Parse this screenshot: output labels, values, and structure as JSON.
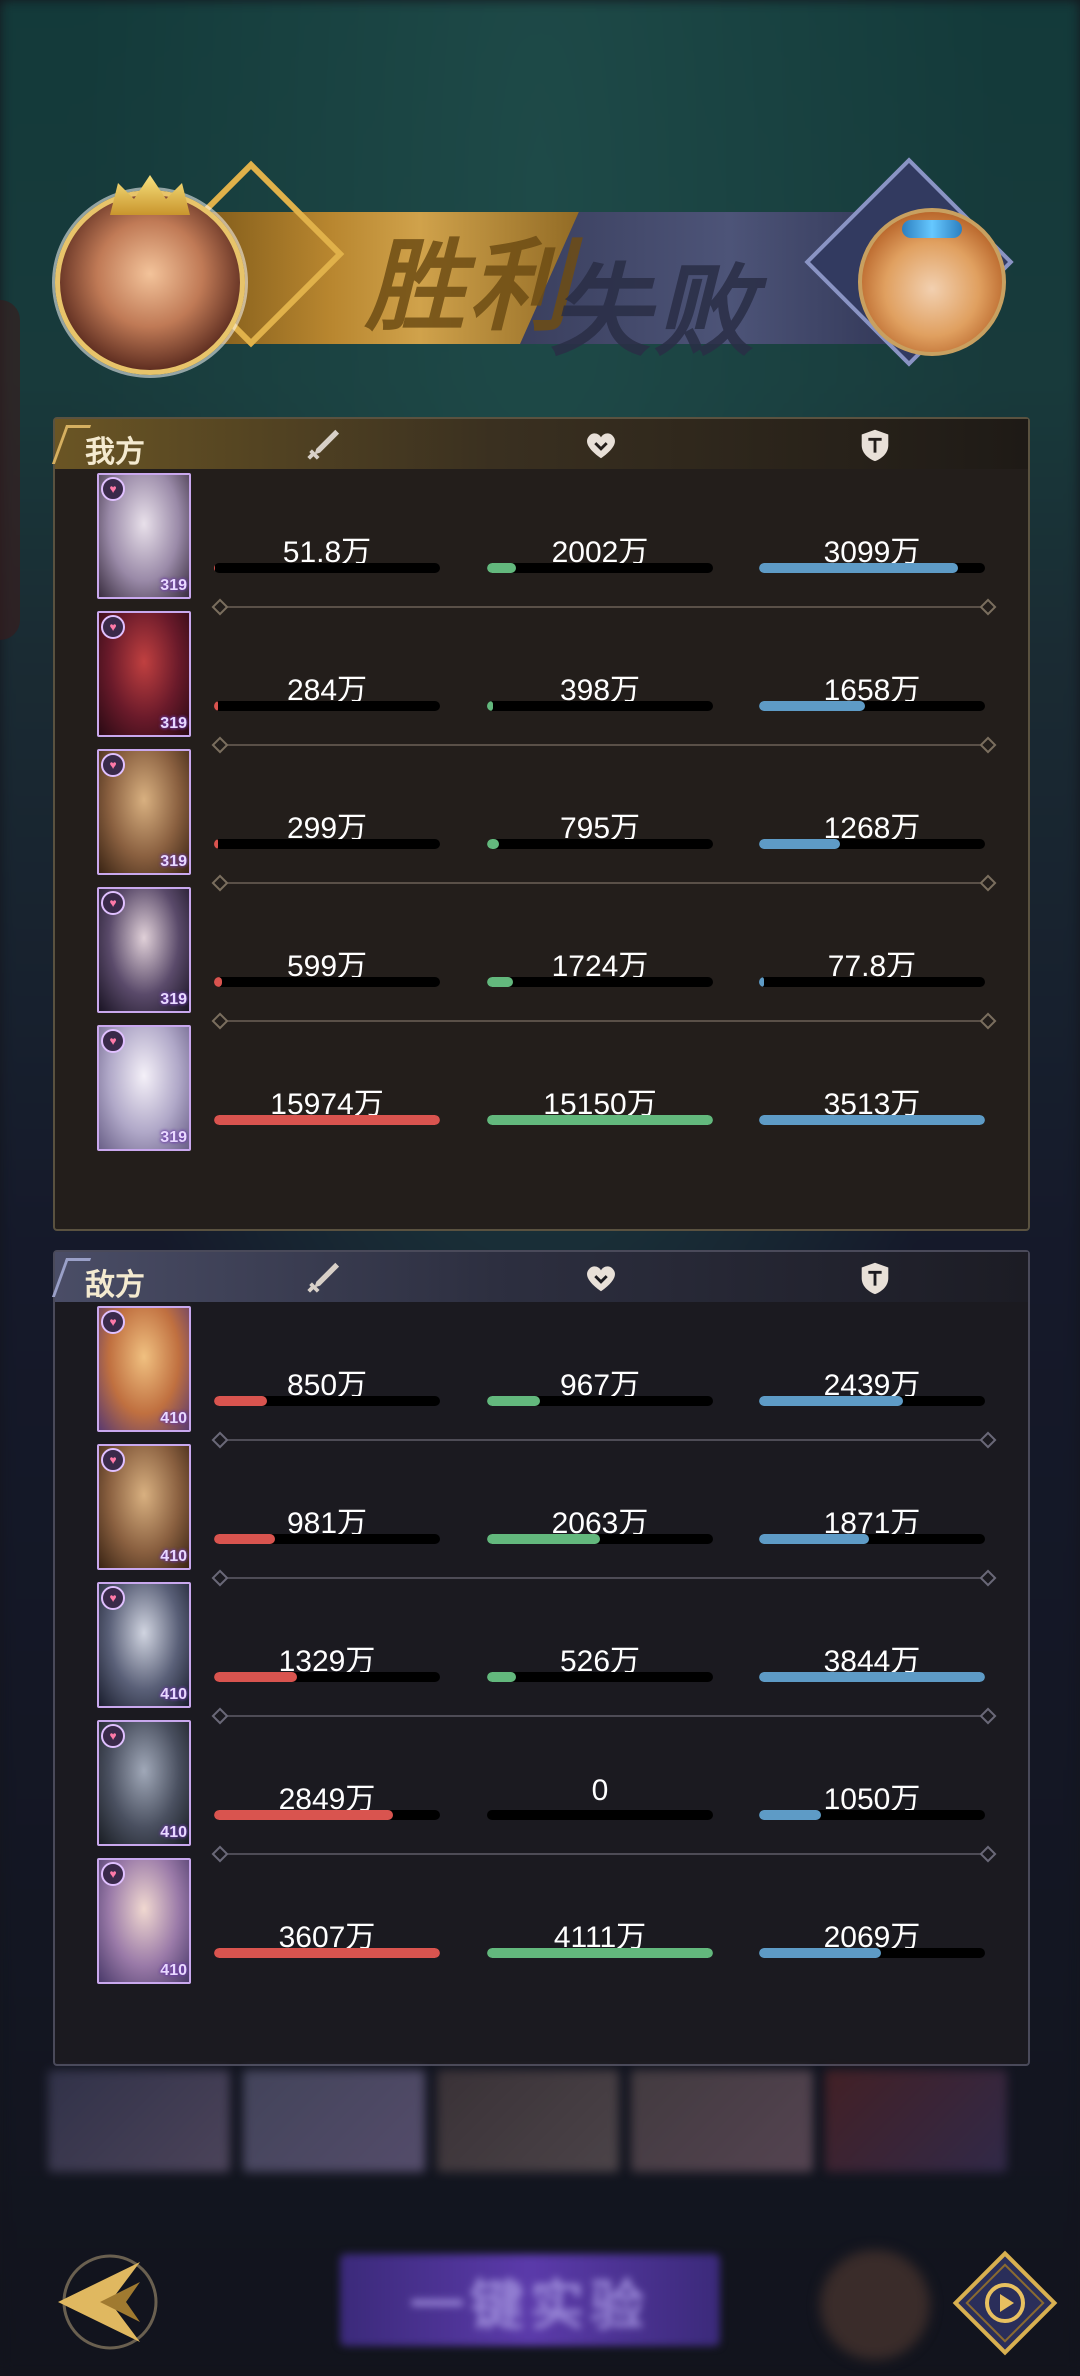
{
  "banner": {
    "victory_text": "胜利",
    "defeat_text": "失败"
  },
  "ours": {
    "label": "我方",
    "rows": [
      {
        "hero_level": "319",
        "damage": "51.8万",
        "heal": "2002万",
        "tank": "3099万",
        "damage_pct": 0.003,
        "heal_pct": 0.13,
        "tank_pct": 0.88
      },
      {
        "hero_level": "319",
        "damage": "284万",
        "heal": "398万",
        "tank": "1658万",
        "damage_pct": 0.018,
        "heal_pct": 0.026,
        "tank_pct": 0.47
      },
      {
        "hero_level": "319",
        "damage": "299万",
        "heal": "795万",
        "tank": "1268万",
        "damage_pct": 0.019,
        "heal_pct": 0.052,
        "tank_pct": 0.36
      },
      {
        "hero_level": "319",
        "damage": "599万",
        "heal": "1724万",
        "tank": "77.8万",
        "damage_pct": 0.037,
        "heal_pct": 0.114,
        "tank_pct": 0.022
      },
      {
        "hero_level": "319",
        "damage": "15974万",
        "heal": "15150万",
        "tank": "3513万",
        "damage_pct": 1.0,
        "heal_pct": 1.0,
        "tank_pct": 1.0
      }
    ]
  },
  "enemy": {
    "label": "敌方",
    "rows": [
      {
        "hero_level": "410",
        "damage": "850万",
        "heal": "967万",
        "tank": "2439万",
        "damage_pct": 0.236,
        "heal_pct": 0.235,
        "tank_pct": 0.635
      },
      {
        "hero_level": "410",
        "damage": "981万",
        "heal": "2063万",
        "tank": "1871万",
        "damage_pct": 0.272,
        "heal_pct": 0.502,
        "tank_pct": 0.487
      },
      {
        "hero_level": "410",
        "damage": "1329万",
        "heal": "526万",
        "tank": "3844万",
        "damage_pct": 0.368,
        "heal_pct": 0.128,
        "tank_pct": 1.0
      },
      {
        "hero_level": "410",
        "damage": "2849万",
        "heal": "0",
        "tank": "1050万",
        "damage_pct": 0.79,
        "heal_pct": 0.0,
        "tank_pct": 0.273
      },
      {
        "hero_level": "410",
        "damage": "3607万",
        "heal": "4111万",
        "tank": "2069万",
        "damage_pct": 1.0,
        "heal_pct": 1.0,
        "tank_pct": 0.538
      }
    ]
  },
  "columns": {
    "damage_icon": "sword-icon",
    "heal_icon": "heart-icon",
    "tank_icon": "shield-icon"
  },
  "colors": {
    "damage": "#d9544f",
    "heal": "#63b87d",
    "tank": "#5e9bc6"
  },
  "bottom": {
    "one_key_label": "一键实验"
  }
}
